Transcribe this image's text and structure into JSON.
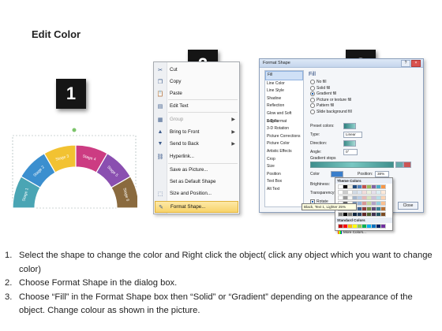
{
  "title": "Edit Color",
  "badges": [
    "1",
    "2",
    "3"
  ],
  "stages": [
    "Stage 1",
    "Stage 2",
    "Stage 3",
    "Stage 4",
    "Stage 5",
    "Stage 6"
  ],
  "colors": {
    "stage1": "#4aa5b4",
    "stage2": "#3b8fcf",
    "stage3": "#f2c232",
    "stage4": "#cc3c82",
    "stage5": "#8a4fb0",
    "stage6": "#8a6a3e"
  },
  "context_menu": {
    "items": [
      {
        "label": "Cut",
        "icon": "scissors-icon",
        "enabled": true,
        "submenu": false
      },
      {
        "label": "Copy",
        "icon": "copy-icon",
        "enabled": true,
        "submenu": false
      },
      {
        "label": "Paste",
        "icon": "paste-icon",
        "enabled": true,
        "submenu": false
      },
      {
        "label": "Edit Text",
        "icon": "edit-text-icon",
        "enabled": true,
        "submenu": false
      },
      {
        "label": "Group",
        "icon": "group-icon",
        "enabled": false,
        "submenu": true
      },
      {
        "label": "Bring to Front",
        "icon": "bring-front-icon",
        "enabled": true,
        "submenu": true
      },
      {
        "label": "Send to Back",
        "icon": "send-back-icon",
        "enabled": true,
        "submenu": true
      },
      {
        "label": "Hyperlink...",
        "icon": "hyperlink-icon",
        "enabled": true,
        "submenu": false
      },
      {
        "label": "Save as Picture...",
        "icon": "",
        "enabled": true,
        "submenu": false
      },
      {
        "label": "Set as Default Shape",
        "icon": "",
        "enabled": true,
        "submenu": false
      },
      {
        "label": "Size and Position...",
        "icon": "size-position-icon",
        "enabled": true,
        "submenu": false
      },
      {
        "label": "Format Shape...",
        "icon": "format-shape-icon",
        "enabled": true,
        "submenu": false,
        "highlighted": true
      }
    ]
  },
  "dialog": {
    "title": "Format Shape",
    "sidebar": [
      "Fill",
      "Line Color",
      "Line Style",
      "Shadow",
      "Reflection",
      "Glow and Soft Edges",
      "3-D Format",
      "3-D Rotation",
      "Picture Corrections",
      "Picture Color",
      "Artistic Effects",
      "Crop",
      "Size",
      "Position",
      "Text Box",
      "Alt Text"
    ],
    "fill_heading": "Fill",
    "fill_options": [
      {
        "label": "No fill",
        "checked": false
      },
      {
        "label": "Solid fill",
        "checked": false
      },
      {
        "label": "Gradient fill",
        "checked": true
      },
      {
        "label": "Picture or texture fill",
        "checked": false
      },
      {
        "label": "Pattern fill",
        "checked": false
      },
      {
        "label": "Slide background fill",
        "checked": false
      }
    ],
    "preset_label": "Preset colors:",
    "type_label": "Type:",
    "type_value": "Linear",
    "direction_label": "Direction:",
    "angle_label": "Angle:",
    "angle_value": "0°",
    "gradient_stops_label": "Gradient stops",
    "color_label": "Color",
    "position_label": "Position:",
    "position_value": "38%",
    "brightness_label": "Brightness:",
    "transparency_label": "Transparency:",
    "rotate_label": "Rotate",
    "close_label": "Close"
  },
  "color_popup": {
    "theme_label": "Theme Colors",
    "standard_label": "Standard Colors",
    "more_label": "More Colors...",
    "tooltip": "Black, Text 1, Lighter 25%",
    "theme_colors": [
      "#ffffff",
      "#000000",
      "#eeece1",
      "#1f497d",
      "#4f81bd",
      "#c0504d",
      "#9bbb59",
      "#8064a2",
      "#4bacc6",
      "#f79646"
    ],
    "standard_colors": [
      "#c00000",
      "#ff0000",
      "#ffc000",
      "#ffff00",
      "#92d050",
      "#00b050",
      "#00b0f0",
      "#0070c0",
      "#002060",
      "#7030a0"
    ]
  },
  "instructions": [
    {
      "num": "1.",
      "text": "Select the shape to change the color and Right click the object( click any object which you want to change color)"
    },
    {
      "num": "2.",
      "text": "Choose Format Shape in the dialog box."
    },
    {
      "num": "3.",
      "text": "Choose “Fill” in the Format Shape box then “Solid” or “Gradient” depending on the appearance of the object. Change colour as shown in the picture."
    }
  ]
}
